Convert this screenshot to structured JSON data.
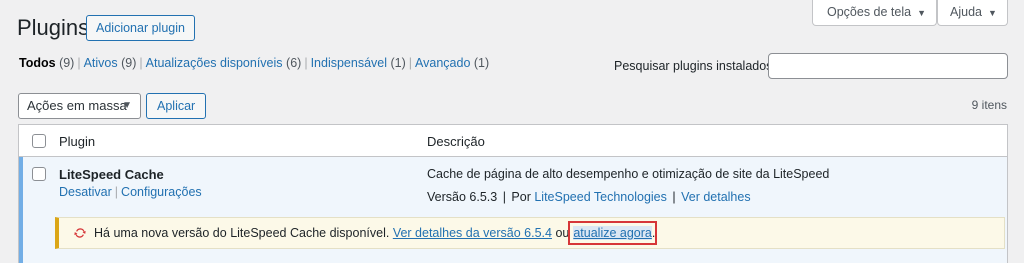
{
  "page": {
    "title": "Plugins",
    "add_button": "Adicionar plugin"
  },
  "top_tabs": {
    "screen_options": "Opções de tela",
    "help": "Ajuda"
  },
  "filters": [
    {
      "label": "Todos",
      "count": "(9)",
      "current": true
    },
    {
      "label": "Ativos",
      "count": "(9)"
    },
    {
      "label": "Atualizações disponíveis",
      "count": "(6)"
    },
    {
      "label": "Indispensável",
      "count": "(1)"
    },
    {
      "label": "Avançado",
      "count": "(1)"
    }
  ],
  "search": {
    "label": "Pesquisar plugins instalados",
    "value": ""
  },
  "bulk": {
    "selected": "Ações em massa",
    "apply": "Aplicar",
    "items_count": "9 itens"
  },
  "table": {
    "headers": {
      "plugin": "Plugin",
      "description": "Descrição"
    },
    "row": {
      "name": "LiteSpeed Cache",
      "actions": {
        "deactivate": "Desativar",
        "settings": "Configurações"
      },
      "description": "Cache de página de alto desempenho e otimização de site da LiteSpeed",
      "version_text": "Versão 6.5.3",
      "by_text": "Por",
      "author": "LiteSpeed Technologies",
      "details": "Ver detalhes"
    },
    "notice": {
      "text": "Há uma nova versão do LiteSpeed Cache disponível.",
      "details_link": "Ver detalhes da versão 6.5.4",
      "or_text": "ou",
      "update_link": "atualize agora",
      "period": "."
    }
  },
  "colors": {
    "accent": "#2271b1",
    "highlight_box": "#d63638",
    "notice_border": "#dba617",
    "update_icon": "#d63638"
  }
}
